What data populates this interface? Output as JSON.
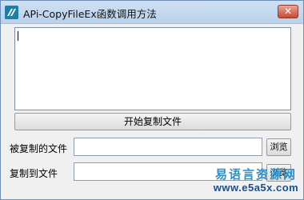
{
  "window": {
    "title": "APi-CopyFileEx函数调用方法",
    "close_label": "✕"
  },
  "output": {
    "value": ""
  },
  "actions": {
    "start_label": "开始复制文件"
  },
  "source_field": {
    "label": "被复制的文件",
    "value": "",
    "browse_label": "浏览"
  },
  "dest_field": {
    "label": "复制到文件",
    "value": "",
    "browse_label": "浏览"
  },
  "watermark": {
    "line1": "易语言资源网",
    "line2": "www.e5a5x.com"
  },
  "icons": {
    "app": "app-icon",
    "close": "close-icon"
  },
  "colors": {
    "titlebar": "#b9d1ea",
    "close_button": "#c74a34",
    "watermark_blue": "#2a8fc8"
  }
}
